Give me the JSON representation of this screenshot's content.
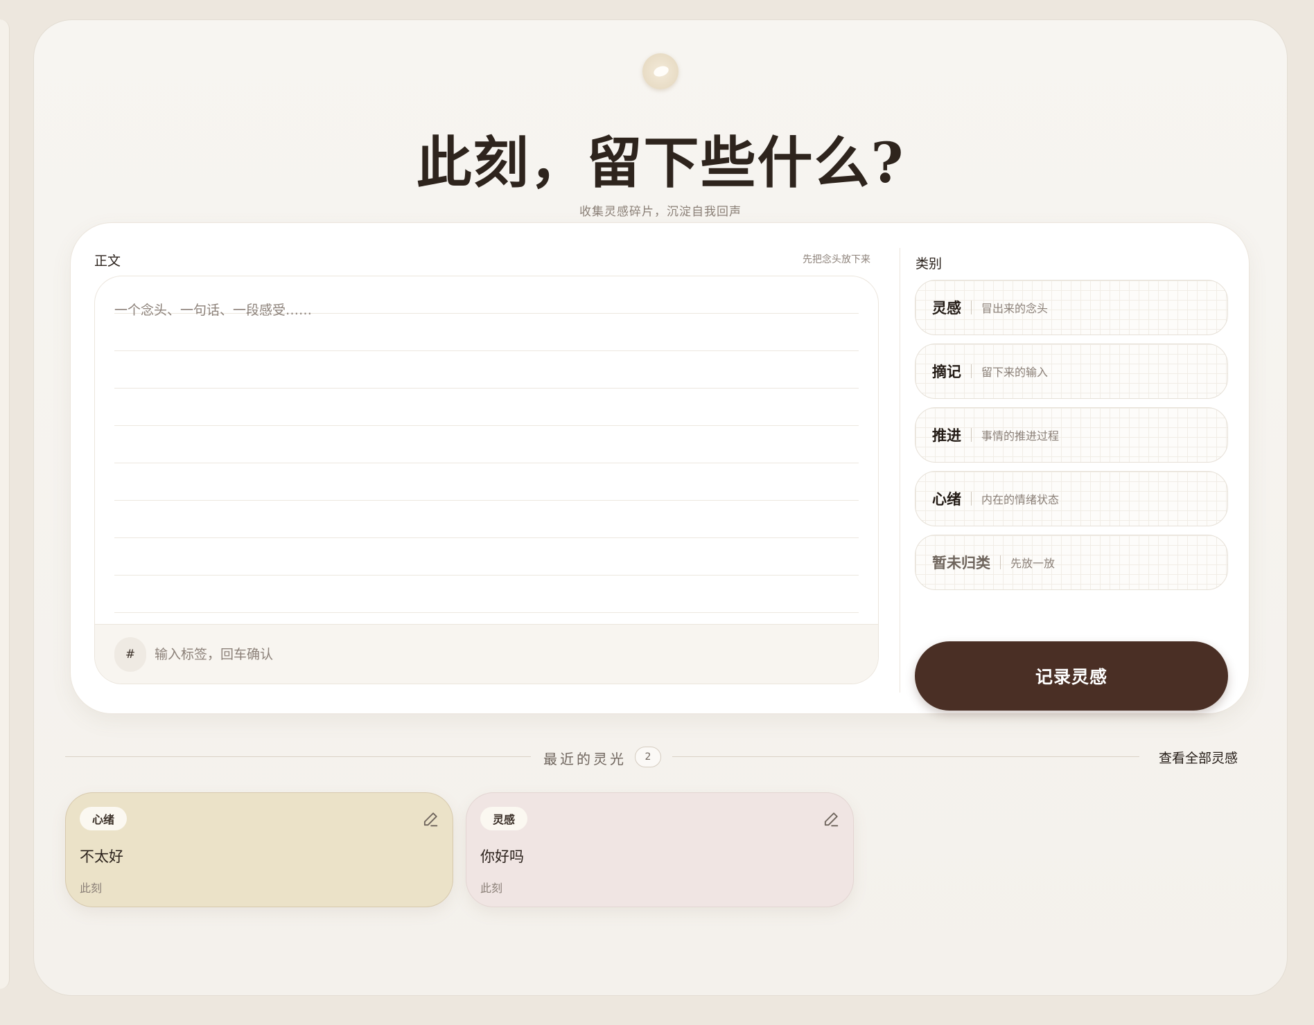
{
  "hero": {
    "title": "此刻，留下些什么?",
    "subtitle": "收集灵感碎片，沉淀自我回声"
  },
  "editor": {
    "label": "正文",
    "hint": "先把念头放下来",
    "placeholder": "一个念头、一句话、一段感受……",
    "value": "",
    "tag_symbol": "#",
    "tag_placeholder": "输入标签，回车确认"
  },
  "categories": {
    "label": "类别",
    "items": [
      {
        "name": "灵感",
        "desc": "冒出来的念头"
      },
      {
        "name": "摘记",
        "desc": "留下来的输入"
      },
      {
        "name": "推进",
        "desc": "事情的推进过程"
      },
      {
        "name": "心绪",
        "desc": "内在的情绪状态"
      },
      {
        "name": "暂未归类",
        "desc": "先放一放"
      }
    ]
  },
  "record_button": "记录灵感",
  "recent": {
    "title": "最近的灵光",
    "count": "2",
    "view_all": "查看全部灵感",
    "notes": [
      {
        "tag": "心绪",
        "text": "不太好",
        "time": "此刻",
        "color": "#ebe2c8"
      },
      {
        "tag": "灵感",
        "text": "你好吗",
        "time": "此刻",
        "color": "#f0e5e3"
      }
    ]
  },
  "colors": {
    "accent": "#4a2f25",
    "background": "#f5f2ed"
  },
  "icons": {
    "logo": "eye-logo-icon",
    "edit": "pencil-icon"
  }
}
